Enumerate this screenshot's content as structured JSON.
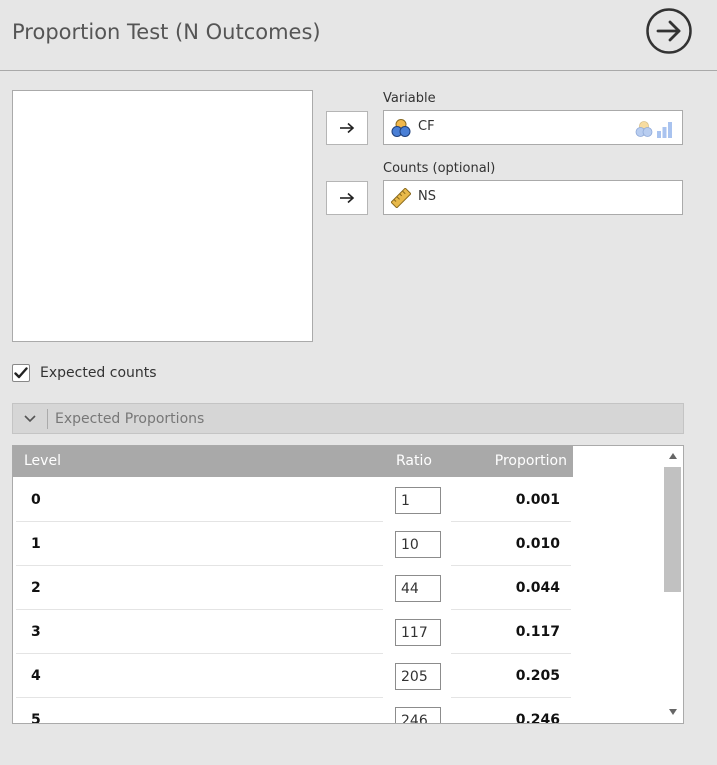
{
  "header": {
    "title": "Proportion Test (N Outcomes)",
    "run_icon": "arrow-circle-right-icon"
  },
  "variable": {
    "label": "Variable",
    "value": "CF",
    "icon": "nominal-variable-icon",
    "type_icon": "nominal-ordinal-type-icon"
  },
  "counts": {
    "label": "Counts (optional)",
    "value": "NS",
    "icon": "ruler-continuous-icon"
  },
  "move_icon": "arrow-right-icon",
  "expected_counts": {
    "label": "Expected counts",
    "checked": true
  },
  "section": {
    "label": "Expected Proportions",
    "expanded": true
  },
  "table": {
    "headers": {
      "level": "Level",
      "ratio": "Ratio",
      "proportion": "Proportion"
    },
    "rows": [
      {
        "level": "0",
        "ratio": "1",
        "proportion": "0.001"
      },
      {
        "level": "1",
        "ratio": "10",
        "proportion": "0.010"
      },
      {
        "level": "2",
        "ratio": "44",
        "proportion": "0.044"
      },
      {
        "level": "3",
        "ratio": "117",
        "proportion": "0.117"
      },
      {
        "level": "4",
        "ratio": "205",
        "proportion": "0.205"
      },
      {
        "level": "5",
        "ratio": "246",
        "proportion": "0.246"
      }
    ]
  },
  "colors": {
    "accent_blue": "#4a7fd6",
    "ruler_yellow": "#e8b94a",
    "header_gray": "#a9a9a9"
  }
}
